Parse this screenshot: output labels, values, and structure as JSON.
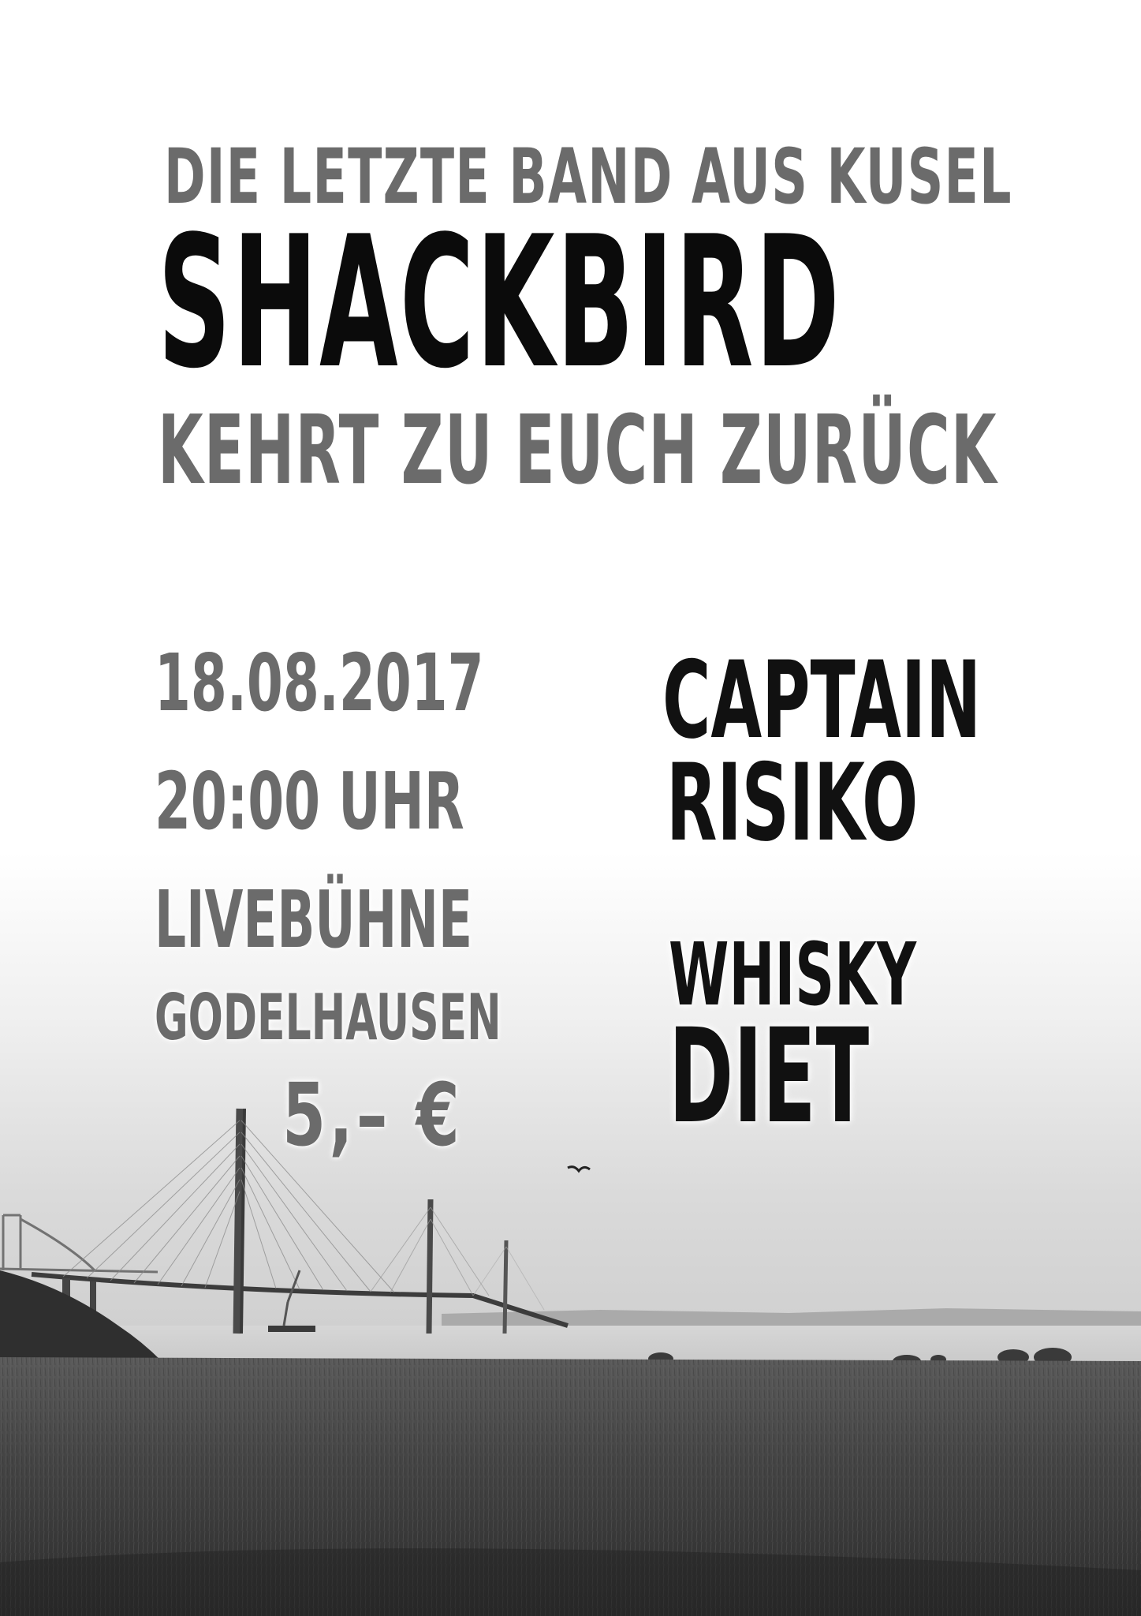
{
  "headline": {
    "top_line": "DIE LETZTE BAND AUS KUSEL",
    "band_name": "SHACKBIRD",
    "bottom_line": "KEHRT ZU EUCH ZURÜCK"
  },
  "event": {
    "date": "18.08.2017",
    "time": "20:00 UHR",
    "venue": "LIVEBÜHNE",
    "town": "GODELHAUSEN",
    "price": "5,– €"
  },
  "support_acts": [
    {
      "line1": "CAPTAIN",
      "line2": "RISIKO"
    },
    {
      "line1": "WHISKY",
      "line2": "DIET"
    }
  ],
  "photo": {
    "subject": "bridge-over-water-landscape",
    "colors": {
      "sky": "#f2f2f2",
      "water": "#d3d3d3",
      "shore": "#3a3a3a",
      "field": "#4a4a4a"
    }
  }
}
